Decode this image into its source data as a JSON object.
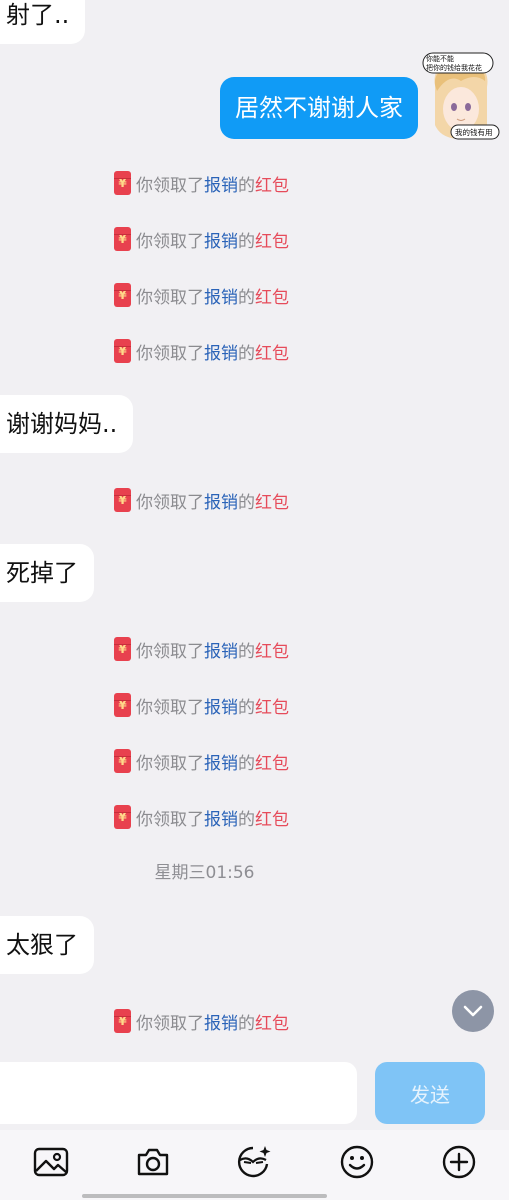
{
  "messages": {
    "m1": "射了..",
    "m2": "居然不谢谢人家",
    "m3": "谢谢妈妈..",
    "m4": "死掉了",
    "m5": "太狠了"
  },
  "sticker": {
    "line1": "你能不能",
    "line2": "把你的钱给我花花",
    "line3": "我的钱有用"
  },
  "red_packet": {
    "prefix": "你领取了",
    "sender": "报销",
    "middle": "的",
    "suffix": "红包",
    "icon": "¥"
  },
  "timestamp": "星期三01:56",
  "composer": {
    "input_value": "",
    "send_label": "发送"
  },
  "toolbar": [
    "image-icon",
    "camera-icon",
    "sticker-icon",
    "emoji-icon",
    "plus-icon"
  ],
  "colors": {
    "background": "#f1f0f3",
    "outgoing_bubble": "#109bf6",
    "red_packet": "#e8414e",
    "sender_link": "#2a63b8",
    "red_text": "#e64b5a",
    "send_button": "#7fc4f6"
  }
}
